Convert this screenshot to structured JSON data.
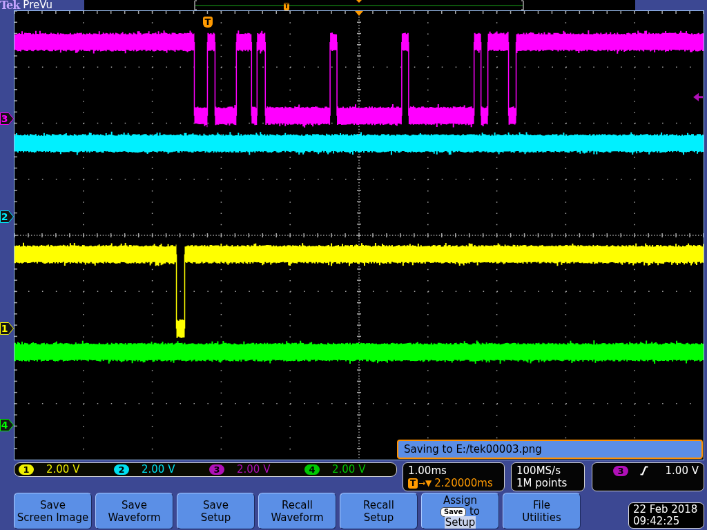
{
  "header": {
    "brand": "Tek",
    "mode": "PreVu"
  },
  "record_view": {
    "trigger_marker": "T"
  },
  "plot": {
    "trigger_marker": "T",
    "traces": [
      {
        "marker": "3",
        "color": "#ff00ff"
      },
      {
        "marker": "2",
        "color": "#00f0ff"
      },
      {
        "marker": "1",
        "color": "#ffff00"
      },
      {
        "marker": "4",
        "color": "#00ff00"
      }
    ],
    "message": "Saving to E:/tek00003.png"
  },
  "channels": [
    {
      "number": "1",
      "color": "#f0f000",
      "scale": "2.00 V"
    },
    {
      "number": "2",
      "color": "#00e0f0",
      "scale": "2.00 V"
    },
    {
      "number": "3",
      "color": "#b010b8",
      "scale": "2.00 V"
    },
    {
      "number": "4",
      "color": "#00c800",
      "scale": "2.00 V"
    }
  ],
  "timebase": {
    "scale": "1.00ms",
    "trigger_marker": "T",
    "delay_symbol": "→▼",
    "delay": "2.20000ms"
  },
  "acquisition": {
    "sample_rate": "100MS/s",
    "record_length": "1M points"
  },
  "trigger": {
    "source": "3",
    "color": "#b010b8",
    "rising_edge": true,
    "level": "1.00 V"
  },
  "buttons": [
    {
      "kind": "text",
      "lines": [
        "Save",
        "Screen Image"
      ]
    },
    {
      "kind": "text",
      "lines": [
        "Save",
        "Waveform"
      ]
    },
    {
      "kind": "text",
      "lines": [
        "Save",
        "Setup"
      ]
    },
    {
      "kind": "text",
      "lines": [
        "Recall",
        "Waveform"
      ]
    },
    {
      "kind": "text",
      "lines": [
        "Recall",
        "Setup"
      ]
    },
    {
      "kind": "assign",
      "label": "Assign",
      "key": "Save",
      "joiner": "to",
      "target": "Setup",
      "selected": true
    },
    {
      "kind": "text",
      "lines": [
        "File",
        "Utilities"
      ]
    }
  ],
  "datetime": {
    "date": "22 Feb 2018",
    "time": "09:42:25"
  }
}
